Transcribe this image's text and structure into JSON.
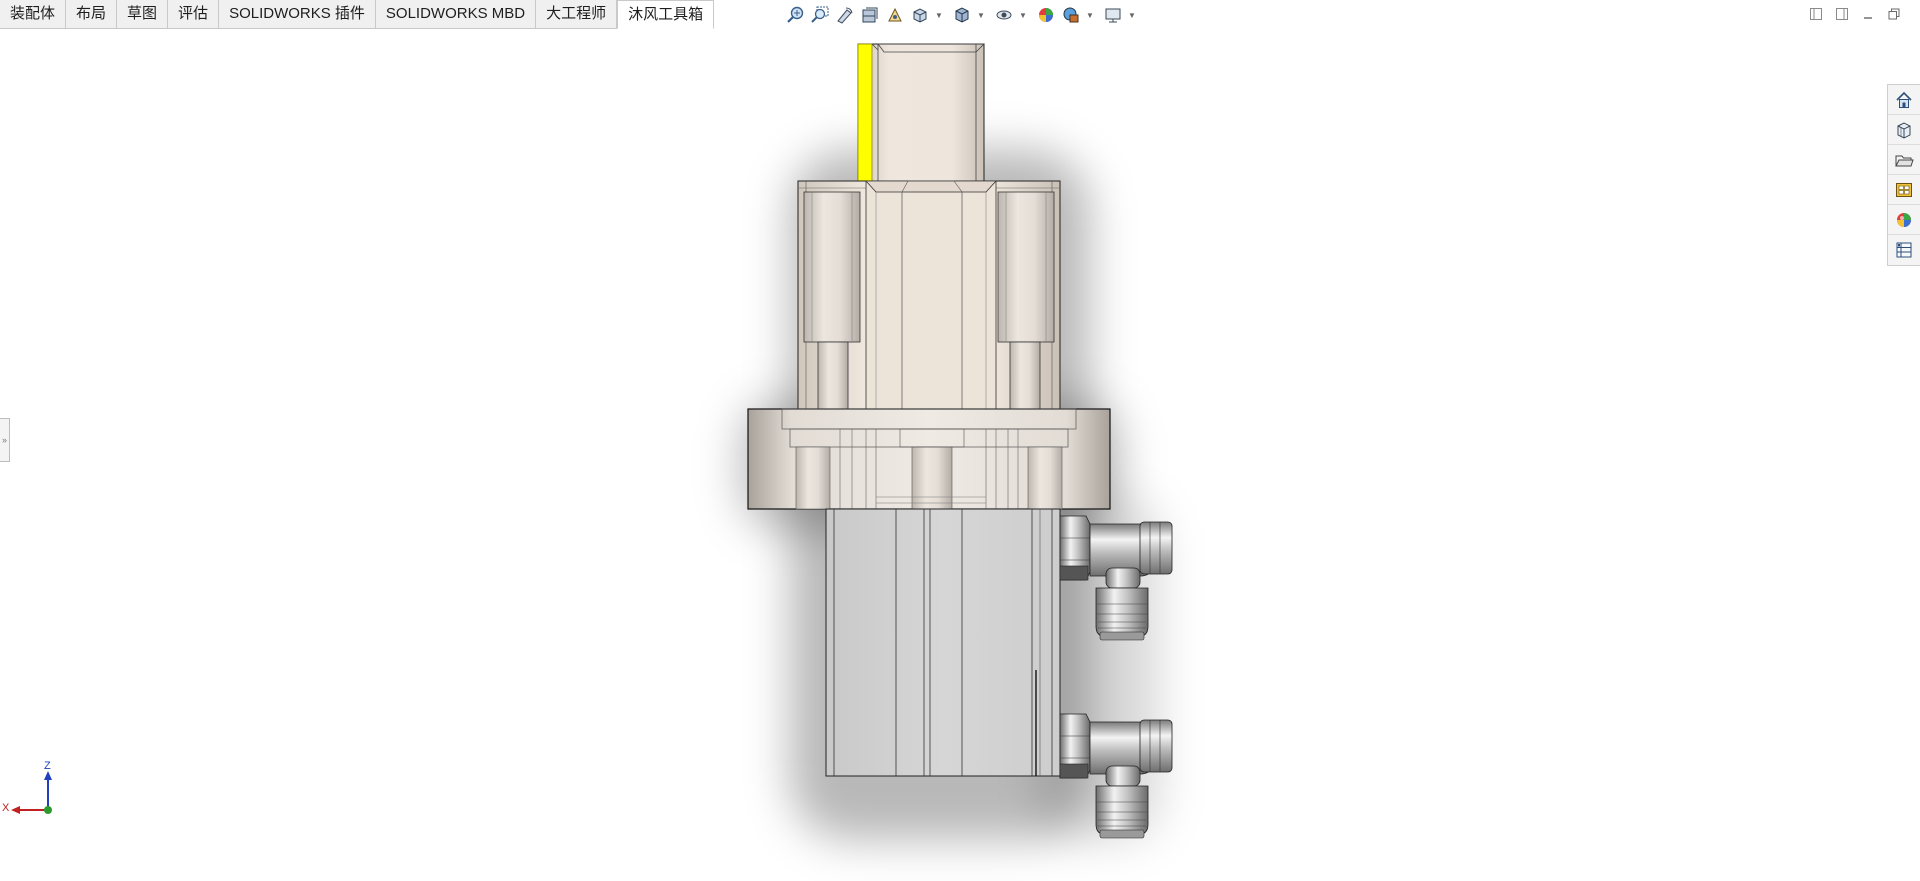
{
  "tabs": [
    {
      "label": "装配体",
      "active": false
    },
    {
      "label": "布局",
      "active": false
    },
    {
      "label": "草图",
      "active": false
    },
    {
      "label": "评估",
      "active": false
    },
    {
      "label": "SOLIDWORKS 插件",
      "active": false
    },
    {
      "label": "SOLIDWORKS MBD",
      "active": false
    },
    {
      "label": "大工程师",
      "active": false
    },
    {
      "label": "沐风工具箱",
      "active": true
    }
  ],
  "hud_tools": [
    "zoom-to-fit-icon",
    "zoom-to-area-icon",
    "previous-view-icon",
    "section-view-icon",
    "dynamic-annotation-view-icon",
    "view-orientation-icon",
    "display-style-icon",
    "hide-show-items-icon",
    "edit-appearance-icon",
    "apply-scene-icon",
    "view-settings-icon"
  ],
  "taskpane": [
    "solidworks-resources-icon",
    "design-library-icon",
    "file-explorer-icon",
    "view-palette-icon",
    "appearances-scenes-icon",
    "custom-properties-icon"
  ],
  "triad": {
    "z_label": "Z",
    "x_label": "X"
  },
  "left_handle_glyph": "»",
  "colors": {
    "highlight": "#ffff00",
    "part_beige": "#efe6dd",
    "body_grey": "#d2d2d2",
    "triad_z": "#1f3fbf",
    "triad_x": "#c0201f",
    "triad_origin": "#2c9a2c"
  }
}
